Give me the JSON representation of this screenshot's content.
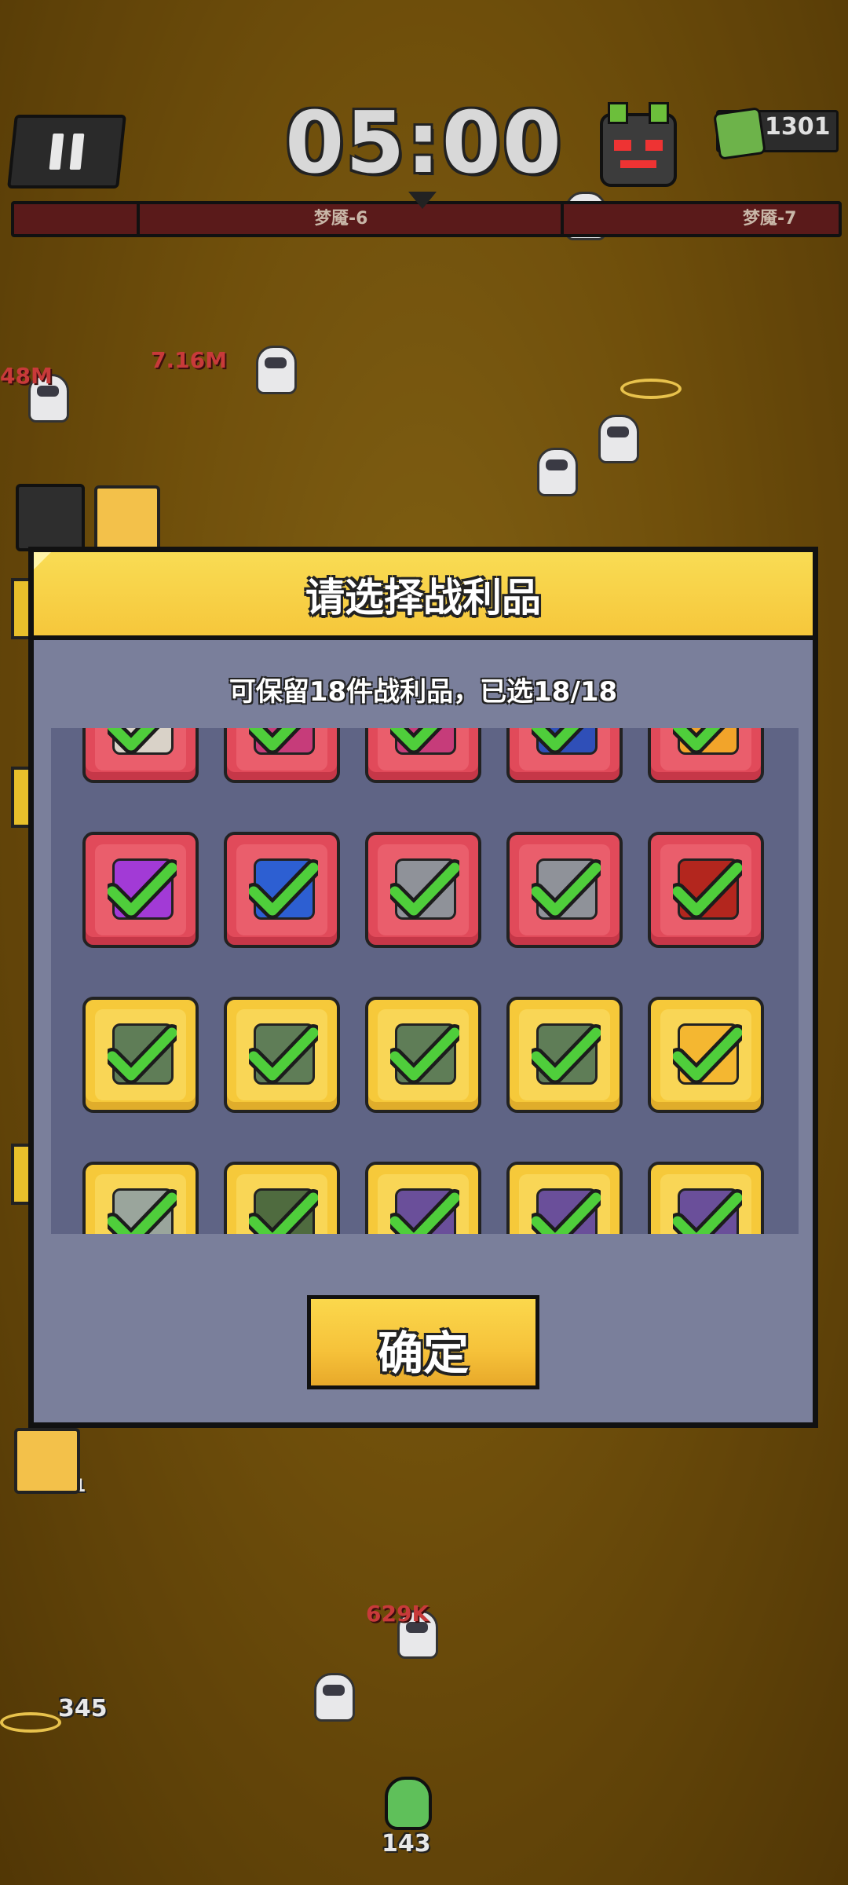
{
  "hud": {
    "timer": "05:00",
    "coins": "1301",
    "stage_current": "梦魇-6",
    "stage_next": "梦魇-7"
  },
  "background": {
    "damage_texts": [
      "48M",
      "7.16M",
      "629K"
    ],
    "counts": [
      "345",
      "143",
      "1"
    ]
  },
  "modal": {
    "title": "请选择战利品",
    "subtitle": "可保留18件战利品，已选18/18",
    "confirm_label": "确定",
    "items": [
      {
        "rarity": "red",
        "icon": "disc-ring-icon",
        "selected": true
      },
      {
        "rarity": "red",
        "icon": "pink-device-icon",
        "selected": true
      },
      {
        "rarity": "red",
        "icon": "pink-device-icon",
        "selected": true
      },
      {
        "rarity": "red",
        "icon": "blue-chip-icon",
        "selected": true
      },
      {
        "rarity": "red",
        "icon": "golden-sword-icon",
        "selected": true
      },
      {
        "rarity": "red",
        "icon": "purple-flower-icon",
        "selected": true
      },
      {
        "rarity": "red",
        "icon": "blue-helmet-icon",
        "selected": true
      },
      {
        "rarity": "red",
        "icon": "grey-dice-icon",
        "selected": true
      },
      {
        "rarity": "red",
        "icon": "grey-dice-icon",
        "selected": true
      },
      {
        "rarity": "red",
        "icon": "red-potion-icon",
        "selected": true
      },
      {
        "rarity": "gold",
        "icon": "circuit-board-icon",
        "selected": true
      },
      {
        "rarity": "gold",
        "icon": "circuit-board-icon",
        "selected": true
      },
      {
        "rarity": "gold",
        "icon": "circuit-board-icon",
        "selected": true
      },
      {
        "rarity": "gold",
        "icon": "circuit-board-icon",
        "selected": true
      },
      {
        "rarity": "gold",
        "icon": "compass-emblem-icon",
        "selected": true
      },
      {
        "rarity": "gold",
        "icon": "grey-ufo-icon",
        "selected": true
      },
      {
        "rarity": "gold",
        "icon": "green-ring-icon",
        "selected": true
      },
      {
        "rarity": "gold",
        "icon": "purple-crystal-icon",
        "selected": true
      },
      {
        "rarity": "gold",
        "icon": "purple-crystal-icon",
        "selected": true
      },
      {
        "rarity": "gold",
        "icon": "purple-crystal-icon",
        "selected": true
      }
    ]
  },
  "colors": {
    "red_rarity": "#e14a5a",
    "gold_rarity": "#f6c93a",
    "check_green": "#4fce3b",
    "modal_bg": "#7a7f9b",
    "header_yellow": "#f9dc54"
  }
}
